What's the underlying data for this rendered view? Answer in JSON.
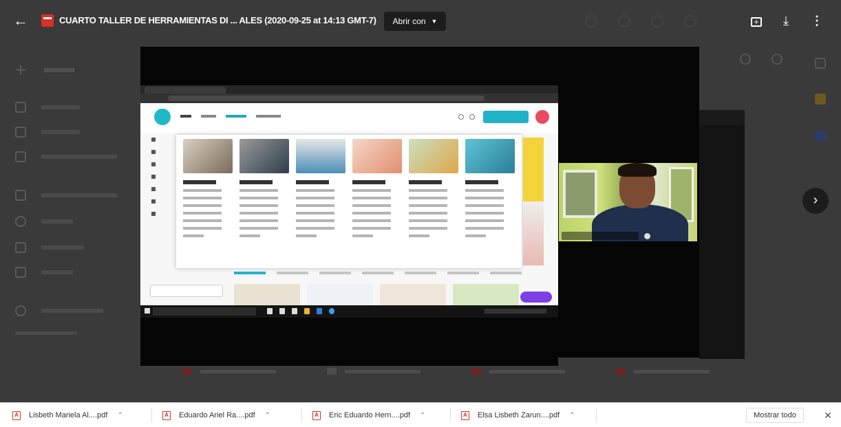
{
  "viewer": {
    "title": "CUARTO TALLER DE HERRAMIENTAS DI ... ALES (2020-09-25 at 14:13 GMT-7)",
    "open_with_label": "Abrir con",
    "back_icon": "arrow-left-icon",
    "add_icon": "add-to-drive-icon",
    "download_icon": "download-icon",
    "more_icon": "more-vert-icon",
    "next_icon": "chevron-right-icon"
  },
  "downloads": {
    "items": [
      {
        "name": "Lisbeth Mariela Al....pdf"
      },
      {
        "name": "Eduardo Ariel Ra....pdf"
      },
      {
        "name": "Eric Eduardo Hern....pdf"
      },
      {
        "name": "Elsa Lisbeth Zarun....pdf"
      }
    ],
    "show_all_label": "Mostrar todo",
    "close_icon": "close-icon",
    "item_icon": "pdf-file-icon",
    "chevron_icon": "chevron-up-icon"
  },
  "colors": {
    "pdf_red": "#d93025",
    "canva_teal": "#20b3c8",
    "overlay_bg": "#3a3a3a"
  }
}
